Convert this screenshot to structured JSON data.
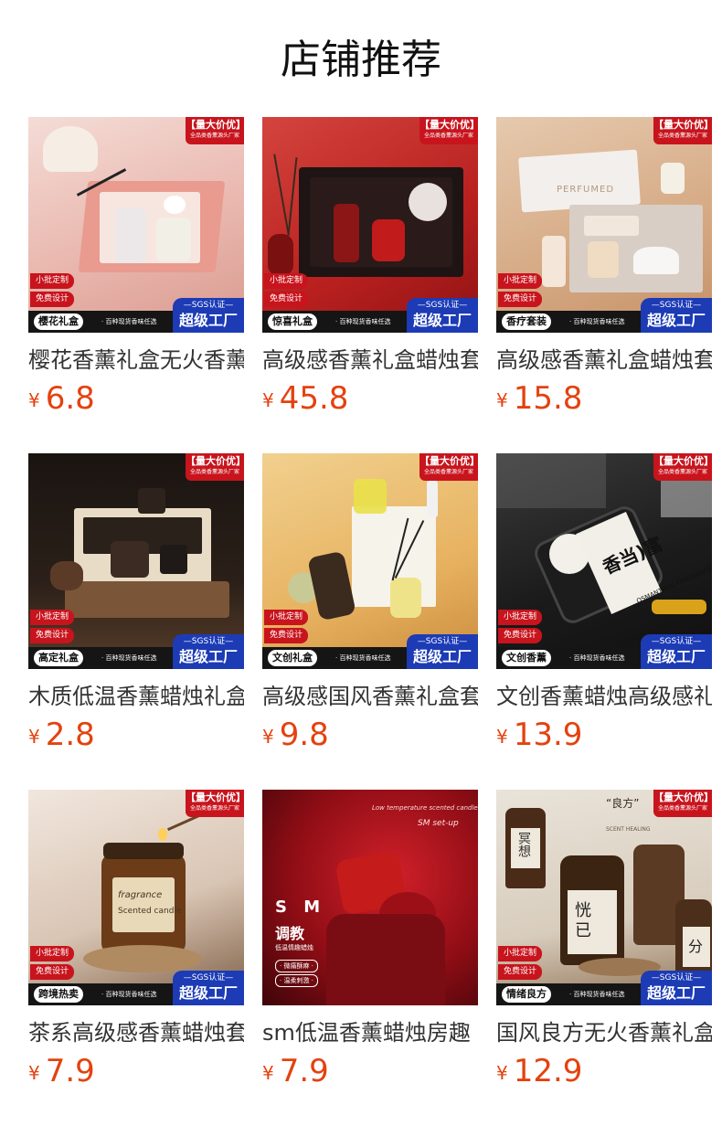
{
  "page": {
    "title": "店铺推荐"
  },
  "badges": {
    "promo_line1": "【量大价优】",
    "promo_line2": "全品类香薰源头厂家",
    "custom": "小批定制",
    "free_design": "免费设计",
    "sgs": "—SGS认证—",
    "factory": "超级工厂",
    "pill_note": "· 百种现货香味任选"
  },
  "products": [
    {
      "pill": "樱花礼盒",
      "title": "樱花香薰礼盒无火香薰",
      "currency": "¥",
      "price": "6.8",
      "overlay": []
    },
    {
      "pill": "惊喜礼盒",
      "title": "高级感香薰礼盒蜡烛套装",
      "currency": "¥",
      "price": "45.8",
      "overlay": []
    },
    {
      "pill": "香疗套装",
      "title": "高级感香薰礼盒蜡烛套装",
      "currency": "¥",
      "price": "15.8",
      "overlay": [
        "PERFUMED"
      ]
    },
    {
      "pill": "高定礼盒",
      "title": "木质低温香薰蜡烛礼盒",
      "currency": "¥",
      "price": "2.8",
      "overlay": []
    },
    {
      "pill": "文创礼盒",
      "title": "高级感国风香薰礼盒套装",
      "currency": "¥",
      "price": "9.8",
      "overlay": []
    },
    {
      "pill": "文创香薰",
      "title": "文创香薰蜡烛高级感礼盒",
      "currency": "¥",
      "price": "13.9",
      "overlay": [
        "香当)富",
        "OSMANTHUS FRAGRANCE"
      ]
    },
    {
      "pill": "跨境热卖",
      "title": "茶系高级感香薰蜡烛套装",
      "currency": "¥",
      "price": "7.9",
      "overlay": [
        "fragrance",
        "Scented candle"
      ]
    },
    {
      "pill": "",
      "title": "sm低温香薰蜡烛房趣",
      "currency": "¥",
      "price": "7.9",
      "overlay": [
        "Low temperature scented candle",
        "SM set-up",
        "S M",
        "调教",
        "低温情趣蜡烛",
        "· 微痛酥麻 ·",
        "· 温柔刺激 ·"
      ]
    },
    {
      "pill": "情绪良方",
      "title": "国风良方无火香薰礼盒",
      "currency": "¥",
      "price": "12.9",
      "overlay": [
        "“良方”",
        "SCENT HEALING",
        "冥想",
        "恍",
        "已",
        "分"
      ]
    }
  ]
}
